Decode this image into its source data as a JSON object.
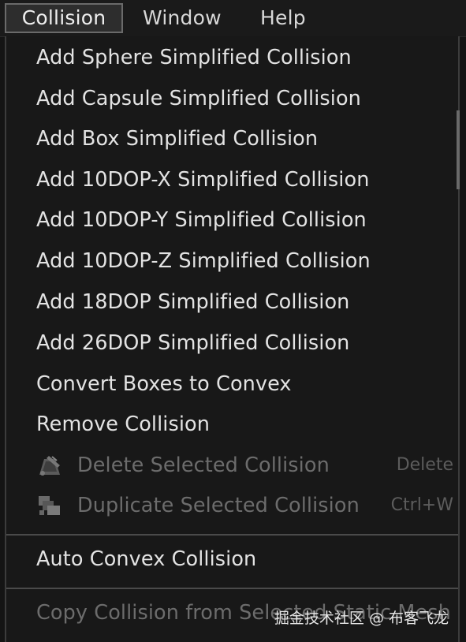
{
  "menubar": {
    "items": [
      {
        "label": "Collision",
        "active": true
      },
      {
        "label": "Window"
      },
      {
        "label": "Help"
      }
    ]
  },
  "dropdown": {
    "items": [
      {
        "label": "Add Sphere Simplified Collision",
        "enabled": true
      },
      {
        "label": "Add Capsule Simplified Collision",
        "enabled": true
      },
      {
        "label": "Add Box Simplified Collision",
        "enabled": true
      },
      {
        "label": "Add 10DOP-X Simplified Collision",
        "enabled": true
      },
      {
        "label": "Add 10DOP-Y Simplified Collision",
        "enabled": true
      },
      {
        "label": "Add 10DOP-Z Simplified Collision",
        "enabled": true
      },
      {
        "label": "Add 18DOP Simplified Collision",
        "enabled": true
      },
      {
        "label": "Add 26DOP Simplified Collision",
        "enabled": true
      },
      {
        "label": "Convert Boxes to Convex",
        "enabled": true
      },
      {
        "label": "Remove Collision",
        "enabled": true
      },
      {
        "label": "Delete Selected Collision",
        "enabled": false,
        "shortcut": "Delete",
        "icon": "delete-collision-icon"
      },
      {
        "label": "Duplicate Selected Collision",
        "enabled": false,
        "shortcut": "Ctrl+W",
        "icon": "duplicate-collision-icon"
      },
      {
        "label": "Auto Convex Collision",
        "enabled": true
      },
      {
        "label": "Copy Collision from Selected Static Mesh",
        "enabled": false
      }
    ]
  },
  "colors": {
    "background": "#181818",
    "text_enabled": "#e3e3e3",
    "text_disabled": "#6c6c6c",
    "separator": "#4a4a4a"
  },
  "watermark": {
    "text": "掘金技术社区 @ 布客飞龙"
  }
}
